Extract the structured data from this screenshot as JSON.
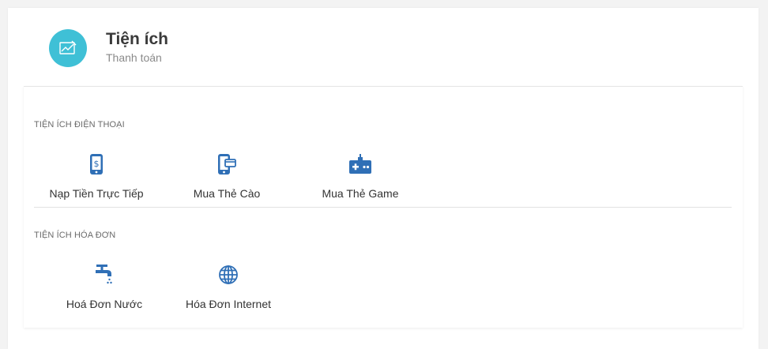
{
  "header": {
    "title": "Tiện ích",
    "subtitle": "Thanh toán",
    "icon": "chart-icon",
    "icon_bg": "#3fc0d6"
  },
  "sections": [
    {
      "title": "TIỆN ÍCH ĐIỆN THOẠI",
      "items": [
        {
          "label": "Nạp Tiền Trực Tiếp",
          "icon": "phone-dollar-icon"
        },
        {
          "label": "Mua Thẻ Cào",
          "icon": "phone-card-icon"
        },
        {
          "label": "Mua Thẻ Game",
          "icon": "gamepad-icon"
        }
      ]
    },
    {
      "title": "TIỆN ÍCH HÓA ĐƠN",
      "items": [
        {
          "label": "Hoá Đơn Nước",
          "icon": "water-tap-icon"
        },
        {
          "label": "Hóa Đơn Internet",
          "icon": "globe-icon"
        }
      ]
    }
  ],
  "colors": {
    "icon": "#2f6fb6",
    "accent": "#3fc0d6"
  }
}
